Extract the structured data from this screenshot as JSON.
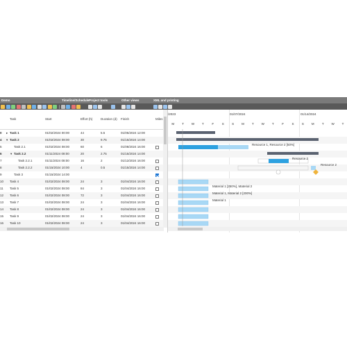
{
  "ribbon": {
    "groups": [
      "Demo",
      "Timeline/Schedule",
      "Project tools",
      "Other views",
      "XML and printing"
    ]
  },
  "grid": {
    "headers": {
      "task": "Task",
      "start": "Start",
      "effort": "Effort (h)",
      "duration": "Duration (d)",
      "finish": "Finish",
      "milestone": "Miles"
    },
    "rows": [
      {
        "idx": "0",
        "name": "Task 1",
        "start": "01/02/2024 00:00",
        "effort": "44",
        "duration": "5.5",
        "finish": "01/05/2024 12:00",
        "indent": 0,
        "bold": true,
        "expand": "▸",
        "check": "none"
      },
      {
        "idx": "4",
        "name": "Task 2",
        "start": "01/02/2024 08:00",
        "effort": "30",
        "duration": "9.75",
        "finish": "01/15/2024 14:00",
        "indent": 0,
        "bold": true,
        "expand": "▾",
        "check": "none"
      },
      {
        "idx": "5",
        "name": "Task 2.1",
        "start": "01/02/2024 08:00",
        "effort": "60",
        "duration": "6",
        "finish": "01/08/2024 16:00",
        "indent": 1,
        "bold": false,
        "expand": "",
        "check": "off"
      },
      {
        "idx": "6",
        "name": "Task 2.2",
        "start": "01/11/2024 08:00",
        "effort": "20",
        "duration": "2.75",
        "finish": "01/15/2024 14:00",
        "indent": 1,
        "bold": true,
        "expand": "▾",
        "check": "none"
      },
      {
        "idx": "7",
        "name": "Task 2.2.1",
        "start": "01/11/2024 08:00",
        "effort": "16",
        "duration": "2",
        "finish": "01/12/2024 16:00",
        "indent": 2,
        "bold": false,
        "expand": "",
        "check": "off"
      },
      {
        "idx": "8",
        "name": "Task 2.2.2",
        "start": "01/15/2024 10:00",
        "effort": "4",
        "duration": "0.5",
        "finish": "01/15/2024 14:00",
        "indent": 2,
        "bold": false,
        "expand": "",
        "check": "off"
      },
      {
        "idx": "9",
        "name": "Task 3",
        "start": "01/15/2024 14:00",
        "effort": "",
        "duration": "",
        "finish": "",
        "indent": 1,
        "bold": false,
        "expand": "",
        "check": "on"
      },
      {
        "idx": "10",
        "name": "Task 4",
        "start": "01/02/2024 08:00",
        "effort": "24",
        "duration": "3",
        "finish": "01/04/2024 16:00",
        "indent": 0,
        "bold": false,
        "expand": "",
        "check": "off"
      },
      {
        "idx": "11",
        "name": "Task 5",
        "start": "01/02/2024 08:00",
        "effort": "84",
        "duration": "3",
        "finish": "01/04/2024 16:00",
        "indent": 0,
        "bold": false,
        "expand": "",
        "check": "off"
      },
      {
        "idx": "12",
        "name": "Task 6",
        "start": "01/02/2024 08:00",
        "effort": "72",
        "duration": "3",
        "finish": "01/04/2024 16:00",
        "indent": 0,
        "bold": false,
        "expand": "",
        "check": "off"
      },
      {
        "idx": "13",
        "name": "Task 7",
        "start": "01/02/2024 08:00",
        "effort": "24",
        "duration": "3",
        "finish": "01/04/2024 16:00",
        "indent": 0,
        "bold": false,
        "expand": "",
        "check": "off"
      },
      {
        "idx": "14",
        "name": "Task 8",
        "start": "01/02/2024 08:00",
        "effort": "24",
        "duration": "3",
        "finish": "01/04/2024 16:00",
        "indent": 0,
        "bold": false,
        "expand": "",
        "check": "off"
      },
      {
        "idx": "15",
        "name": "Task 9",
        "start": "01/02/2024 08:00",
        "effort": "24",
        "duration": "3",
        "finish": "01/04/2024 16:00",
        "indent": 0,
        "bold": false,
        "expand": "",
        "check": "off"
      },
      {
        "idx": "16",
        "name": "Task 10",
        "start": "01/02/2024 08:00",
        "effort": "24",
        "duration": "3",
        "finish": "01/04/2024 16:00",
        "indent": 0,
        "bold": false,
        "expand": "",
        "check": "off"
      }
    ]
  },
  "chart": {
    "week_labels": [
      "/2023",
      "01/07/2024",
      "01/14/2024"
    ],
    "days": [
      "M",
      "T",
      "W",
      "T",
      "F",
      "S",
      "S",
      "M",
      "T",
      "W",
      "T",
      "F",
      "S",
      "S",
      "M",
      "T",
      "W",
      "T"
    ],
    "assignments": [
      "Resource 1, Resource 2 [50%]",
      "Resource 2",
      "Resource 2",
      "Material 1 [250%], Material 2",
      "Material 1, Material 2 [200%]",
      "Material 1"
    ]
  },
  "colors": {
    "summary_bar": "#5a6270",
    "task_bar": "#a8d8f5",
    "completed": "#2da1e0",
    "milestone": "#f0b43c",
    "ribbon": "#595959"
  }
}
